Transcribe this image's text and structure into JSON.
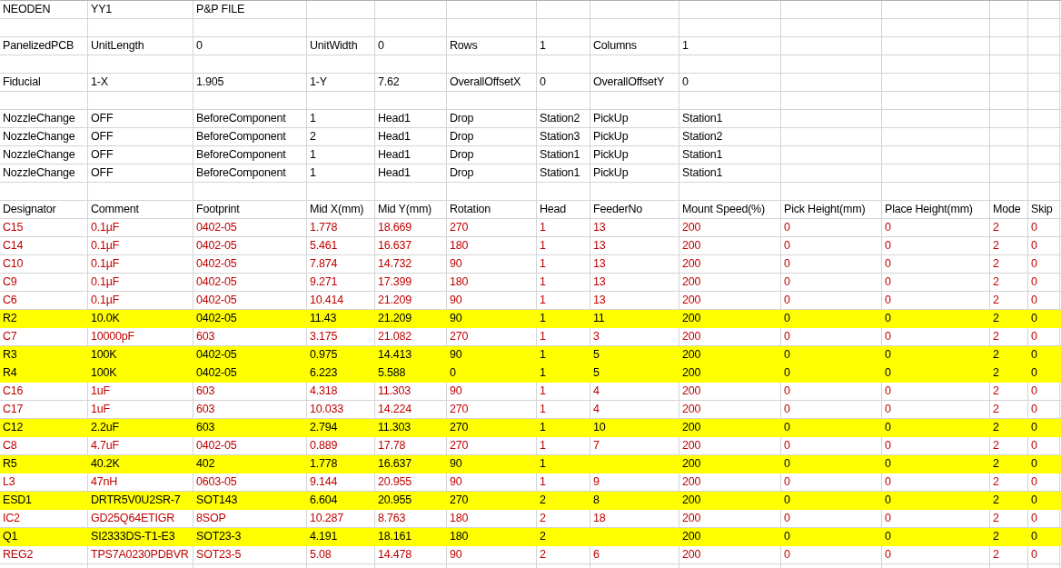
{
  "sheet": {
    "rows": [
      {
        "kind": "text",
        "cells": [
          "NEODEN",
          "YY1",
          "P&P FILE"
        ]
      },
      {
        "kind": "blank"
      },
      {
        "kind": "text",
        "cells": [
          "PanelizedPCB",
          "UnitLength",
          "0",
          "UnitWidth",
          "0",
          "Rows",
          "1",
          "Columns",
          "1"
        ]
      },
      {
        "kind": "blank"
      },
      {
        "kind": "text",
        "cells": [
          "Fiducial",
          "1-X",
          "1.905",
          "1-Y",
          "7.62",
          "OverallOffsetX",
          "0",
          "OverallOffsetY",
          "0"
        ]
      },
      {
        "kind": "blank"
      },
      {
        "kind": "text",
        "cells": [
          "NozzleChange",
          "OFF",
          "BeforeComponent",
          "1",
          "Head1",
          "Drop",
          "Station2",
          "PickUp",
          "Station1"
        ]
      },
      {
        "kind": "text",
        "cells": [
          "NozzleChange",
          "OFF",
          "BeforeComponent",
          "2",
          "Head1",
          "Drop",
          "Station3",
          "PickUp",
          "Station2"
        ]
      },
      {
        "kind": "text",
        "cells": [
          "NozzleChange",
          "OFF",
          "BeforeComponent",
          "1",
          "Head1",
          "Drop",
          "Station1",
          "PickUp",
          "Station1"
        ]
      },
      {
        "kind": "text",
        "cells": [
          "NozzleChange",
          "OFF",
          "BeforeComponent",
          "1",
          "Head1",
          "Drop",
          "Station1",
          "PickUp",
          "Station1"
        ]
      },
      {
        "kind": "blank"
      },
      {
        "kind": "header",
        "cells": [
          "Designator",
          "Comment",
          "Footprint",
          "Mid X(mm)",
          "Mid Y(mm)",
          "Rotation",
          "Head",
          "FeederNo",
          "Mount Speed(%)",
          "Pick Height(mm)",
          "Place Height(mm)",
          "Mode",
          "Skip"
        ]
      },
      {
        "kind": "component",
        "highlighted": false,
        "cells": [
          "C15",
          "0.1µF",
          "0402-05",
          "1.778",
          "18.669",
          "270",
          "1",
          "13",
          "200",
          "0",
          "0",
          "2",
          "0"
        ]
      },
      {
        "kind": "component",
        "highlighted": false,
        "cells": [
          "C14",
          "0.1µF",
          "0402-05",
          "5.461",
          "16.637",
          "180",
          "1",
          "13",
          "200",
          "0",
          "0",
          "2",
          "0"
        ]
      },
      {
        "kind": "component",
        "highlighted": false,
        "cells": [
          "C10",
          "0.1µF",
          "0402-05",
          "7.874",
          "14.732",
          "90",
          "1",
          "13",
          "200",
          "0",
          "0",
          "2",
          "0"
        ]
      },
      {
        "kind": "component",
        "highlighted": false,
        "cells": [
          "C9",
          "0.1µF",
          "0402-05",
          "9.271",
          "17.399",
          "180",
          "1",
          "13",
          "200",
          "0",
          "0",
          "2",
          "0"
        ]
      },
      {
        "kind": "component",
        "highlighted": false,
        "cells": [
          "C6",
          "0.1µF",
          "0402-05",
          "10.414",
          "21.209",
          "90",
          "1",
          "13",
          "200",
          "0",
          "0",
          "2",
          "0"
        ]
      },
      {
        "kind": "component",
        "highlighted": true,
        "cells": [
          "R2",
          "10.0K",
          "0402-05",
          "11.43",
          "21.209",
          "90",
          "1",
          "11",
          "200",
          "0",
          "0",
          "2",
          "0"
        ]
      },
      {
        "kind": "component",
        "highlighted": false,
        "cells": [
          "C7",
          "10000pF",
          "603",
          "3.175",
          "21.082",
          "270",
          "1",
          "3",
          "200",
          "0",
          "0",
          "2",
          "0"
        ]
      },
      {
        "kind": "component",
        "highlighted": true,
        "cells": [
          "R3",
          "100K",
          "0402-05",
          "0.975",
          "14.413",
          "90",
          "1",
          "5",
          "200",
          "0",
          "0",
          "2",
          "0"
        ]
      },
      {
        "kind": "component",
        "highlighted": true,
        "cells": [
          "R4",
          "100K",
          "0402-05",
          "6.223",
          "5.588",
          "0",
          "1",
          "5",
          "200",
          "0",
          "0",
          "2",
          "0"
        ]
      },
      {
        "kind": "component",
        "highlighted": false,
        "cells": [
          "C16",
          "1uF",
          "603",
          "4.318",
          "11.303",
          "90",
          "1",
          "4",
          "200",
          "0",
          "0",
          "2",
          "0"
        ]
      },
      {
        "kind": "component",
        "highlighted": false,
        "cells": [
          "C17",
          "1uF",
          "603",
          "10.033",
          "14.224",
          "270",
          "1",
          "4",
          "200",
          "0",
          "0",
          "2",
          "0"
        ]
      },
      {
        "kind": "component",
        "highlighted": true,
        "cells": [
          "C12",
          "2.2uF",
          "603",
          "2.794",
          "11.303",
          "270",
          "1",
          "10",
          "200",
          "0",
          "0",
          "2",
          "0"
        ]
      },
      {
        "kind": "component",
        "highlighted": false,
        "cells": [
          "C8",
          "4.7uF",
          "0402-05",
          "0.889",
          "17.78",
          "270",
          "1",
          "7",
          "200",
          "0",
          "0",
          "2",
          "0"
        ]
      },
      {
        "kind": "component",
        "highlighted": true,
        "cells": [
          "R5",
          "40.2K",
          "402",
          "1.778",
          "16.637",
          "90",
          "1",
          null,
          "200",
          "0",
          "0",
          "2",
          "0"
        ]
      },
      {
        "kind": "component",
        "highlighted": false,
        "cells": [
          "L3",
          "47nH",
          "0603-05",
          "9.144",
          "20.955",
          "90",
          "1",
          "9",
          "200",
          "0",
          "0",
          "2",
          "0"
        ]
      },
      {
        "kind": "component",
        "highlighted": true,
        "cells": [
          "ESD1",
          "DRTR5V0U2SR-7",
          "SOT143",
          "6.604",
          "20.955",
          "270",
          "2",
          "8",
          "200",
          "0",
          "0",
          "2",
          "0"
        ]
      },
      {
        "kind": "component",
        "highlighted": false,
        "cells": [
          "IC2",
          "GD25Q64ETIGR",
          "8SOP",
          "10.287",
          "8.763",
          "180",
          "2",
          "18",
          "200",
          "0",
          "0",
          "2",
          "0"
        ]
      },
      {
        "kind": "component",
        "highlighted": true,
        "cells": [
          "Q1",
          "SI2333DS-T1-E3",
          "SOT23-3",
          "4.191",
          "18.161",
          "180",
          "2",
          null,
          "200",
          "0",
          "0",
          "2",
          "0"
        ]
      },
      {
        "kind": "component",
        "highlighted": false,
        "cells": [
          "REG2",
          "TPS7A0230PDBVR",
          "SOT23-5",
          "5.08",
          "14.478",
          "90",
          "2",
          "6",
          "200",
          "0",
          "0",
          "2",
          "0"
        ]
      }
    ]
  }
}
